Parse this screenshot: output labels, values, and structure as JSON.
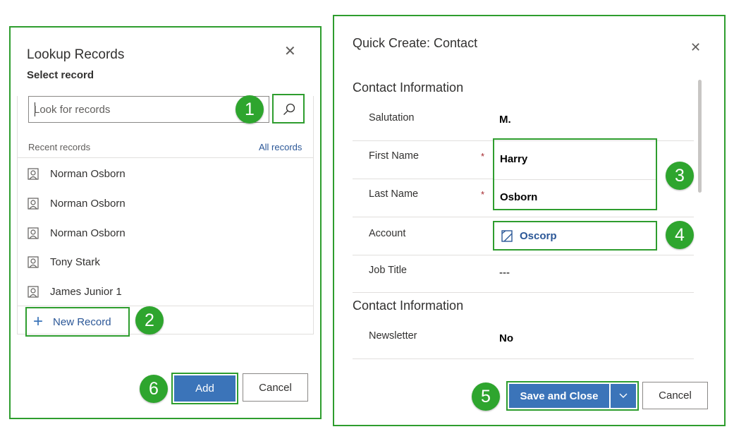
{
  "lookup": {
    "title": "Lookup Records",
    "subtitle": "Select record",
    "search": {
      "placeholder": "Look for records",
      "value": ""
    },
    "recent_label": "Recent records",
    "all_records_link": "All records",
    "records": [
      {
        "name": "Norman Osborn",
        "icon": "contact-icon"
      },
      {
        "name": "Norman Osborn",
        "icon": "contact-icon"
      },
      {
        "name": "Norman Osborn",
        "icon": "contact-icon"
      },
      {
        "name": "Tony Stark",
        "icon": "contact-icon"
      },
      {
        "name": "James Junior 1",
        "icon": "contact-icon"
      }
    ],
    "new_record_label": "New Record",
    "add_label": "Add",
    "cancel_label": "Cancel"
  },
  "quick_create": {
    "title": "Quick Create: Contact",
    "section1_title": "Contact Information",
    "fields": {
      "salutation": {
        "label": "Salutation",
        "value": "M."
      },
      "first_name": {
        "label": "First Name",
        "value": "Harry",
        "required": "*"
      },
      "last_name": {
        "label": "Last Name",
        "value": "Osborn",
        "required": "*"
      },
      "account": {
        "label": "Account",
        "value": "Oscorp"
      },
      "job_title": {
        "label": "Job Title",
        "value": "---"
      }
    },
    "section2_title": "Contact Information",
    "newsletter": {
      "label": "Newsletter",
      "value": "No"
    },
    "save_close_label": "Save and Close",
    "cancel_label": "Cancel"
  },
  "step_badges": [
    "1",
    "2",
    "3",
    "4",
    "5",
    "6"
  ],
  "colors": {
    "highlight_green": "#2e9d2e",
    "primary_blue": "#3b74b9",
    "link_blue": "#2b5797",
    "required_red": "#a4262c"
  }
}
